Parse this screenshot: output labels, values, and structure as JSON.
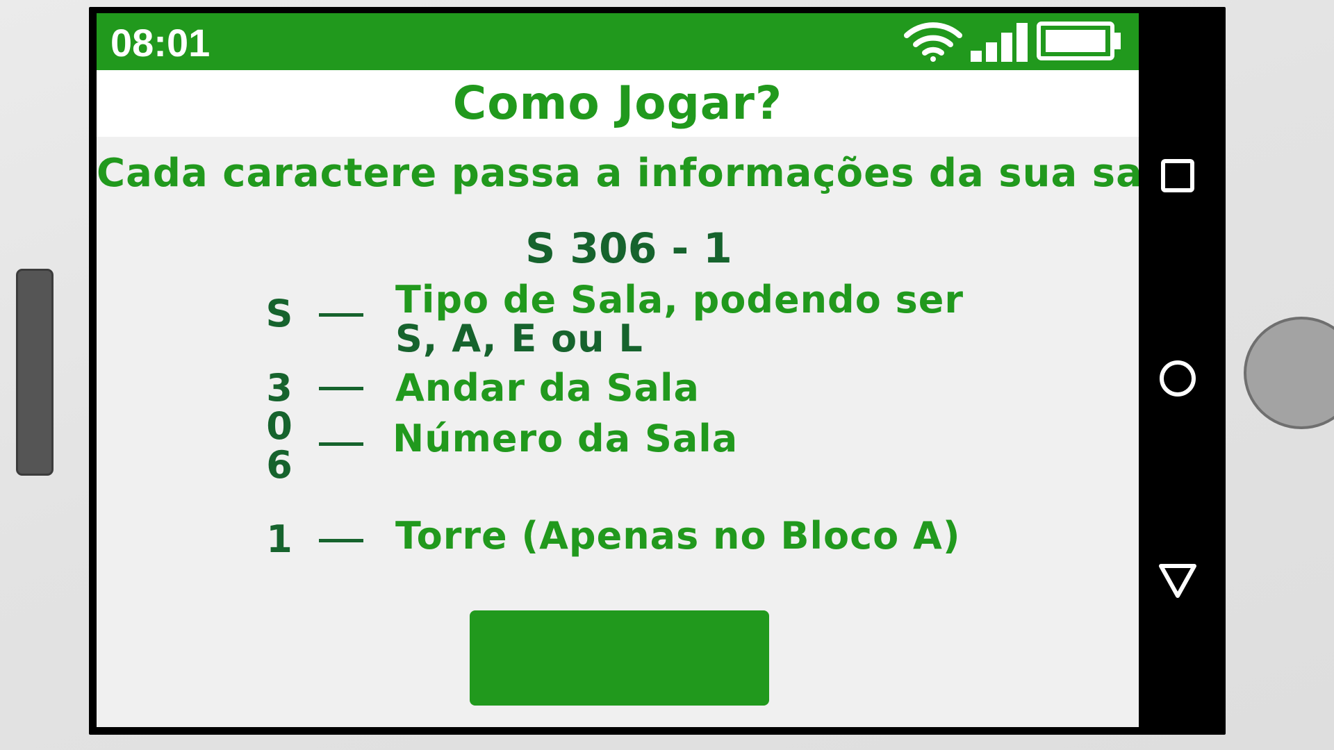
{
  "status_bar": {
    "time": "08:01",
    "icons": [
      "wifi-icon",
      "signal-icon",
      "battery-icon"
    ]
  },
  "screen": {
    "title": "Como Jogar?",
    "subtitle": "Cada caractere passa a informações da sua sala:",
    "code": "S 306 - 1",
    "legend": [
      {
        "chars": "S",
        "text_line1": "Tipo de Sala, podendo ser",
        "text_line2": "S, A, E ou L"
      },
      {
        "chars": "3",
        "text_line1": "Andar da Sala"
      },
      {
        "chars_line1": "0",
        "chars_line2": "6",
        "text_line1": "Número da Sala"
      },
      {
        "chars": "1",
        "text_line1": "Torre (Apenas no Bloco A)"
      }
    ]
  },
  "nav_bar": {
    "items": [
      "square-recents-icon",
      "circle-home-icon",
      "triangle-back-icon"
    ]
  },
  "colors": {
    "accent": "#21991d",
    "dark_green": "#16632d",
    "screen_bg": "#f0f0f0",
    "phone_frame": "#000000"
  }
}
